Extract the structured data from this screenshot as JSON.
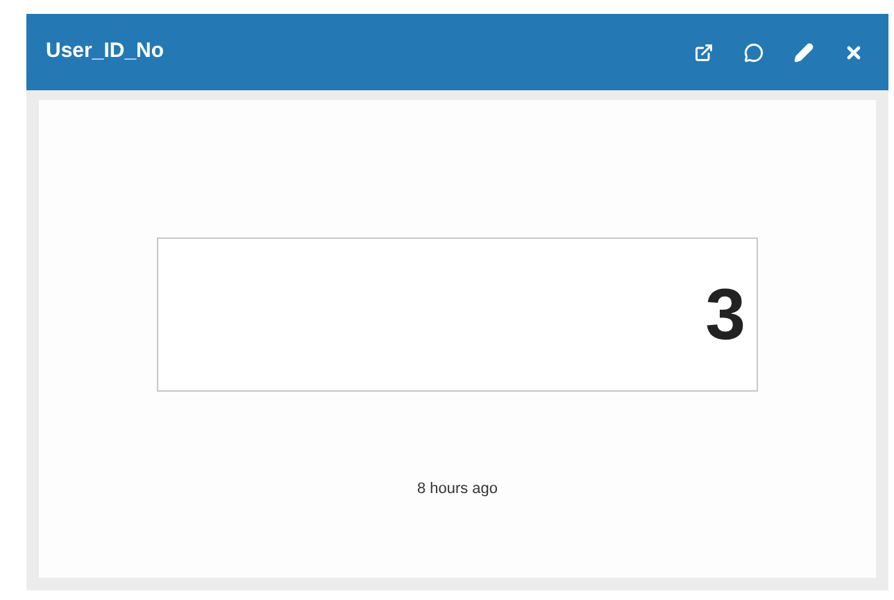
{
  "widget": {
    "title": "User_ID_No"
  },
  "value": "3",
  "timestamp": "8 hours ago"
}
